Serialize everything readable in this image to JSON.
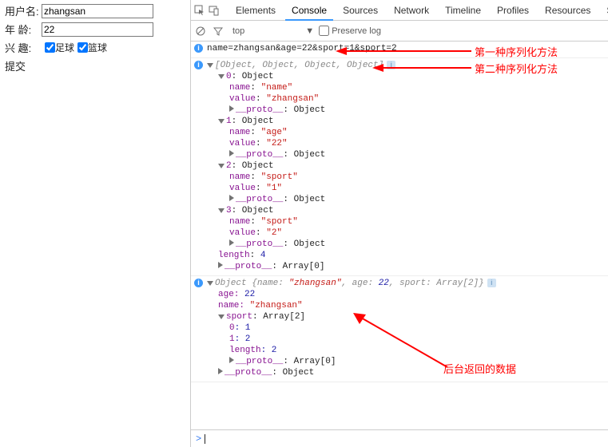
{
  "form": {
    "username_label": "用户名:",
    "username_value": "zhangsan",
    "age_label": "年 龄:",
    "age_value": "22",
    "hobby_label": "兴 趣:",
    "hobby_football": "足球",
    "hobby_basketball": "篮球",
    "submit": "提交"
  },
  "devtools": {
    "tabs": {
      "elements": "Elements",
      "console": "Console",
      "sources": "Sources",
      "network": "Network",
      "timeline": "Timeline",
      "profiles": "Profiles",
      "resources": "Resources",
      "security": "Sec"
    },
    "filter": {
      "top": "top",
      "preserve": "Preserve log"
    }
  },
  "console": {
    "line1": "name=zhangsan&age=22&sport=1&sport=2",
    "array_header": "[Object, Object, Object, Object]",
    "items": [
      {
        "idx": "0",
        "name": "\"name\"",
        "value": "\"zhangsan\""
      },
      {
        "idx": "1",
        "name": "\"age\"",
        "value": "\"22\""
      },
      {
        "idx": "2",
        "name": "\"sport\"",
        "value": "\"1\""
      },
      {
        "idx": "3",
        "name": "\"sport\"",
        "value": "\"2\""
      }
    ],
    "length4": "4",
    "proto_obj": ": Object",
    "proto_arr0": ": Array[0]",
    "obj_header_pre": "Object {",
    "obj_name_k": "name: ",
    "obj_name_v": "\"zhangsan\"",
    "obj_age_k": ", age: ",
    "obj_age_v": "22",
    "obj_sport_k": ", sport: ",
    "obj_sport_v": "Array[2]",
    "obj_header_post": "}",
    "obj_age_line_k": "age: ",
    "obj_age_line_v": "22",
    "obj_name_line_k": "name: ",
    "obj_name_line_v": "\"zhangsan\"",
    "obj_sport_line_k": "sport",
    "obj_sport_line_v": ": Array[2]",
    "sport_0k": "0",
    "sport_0v": ": 1",
    "sport_1k": "1",
    "sport_1v": ": 2",
    "sport_len_k": "length",
    "sport_len_v": ": 2",
    "proto_label": "__proto__"
  },
  "annotations": {
    "a1": "第一种序列化方法",
    "a2": "第二种序列化方法",
    "a3": "后台返回的数据"
  }
}
